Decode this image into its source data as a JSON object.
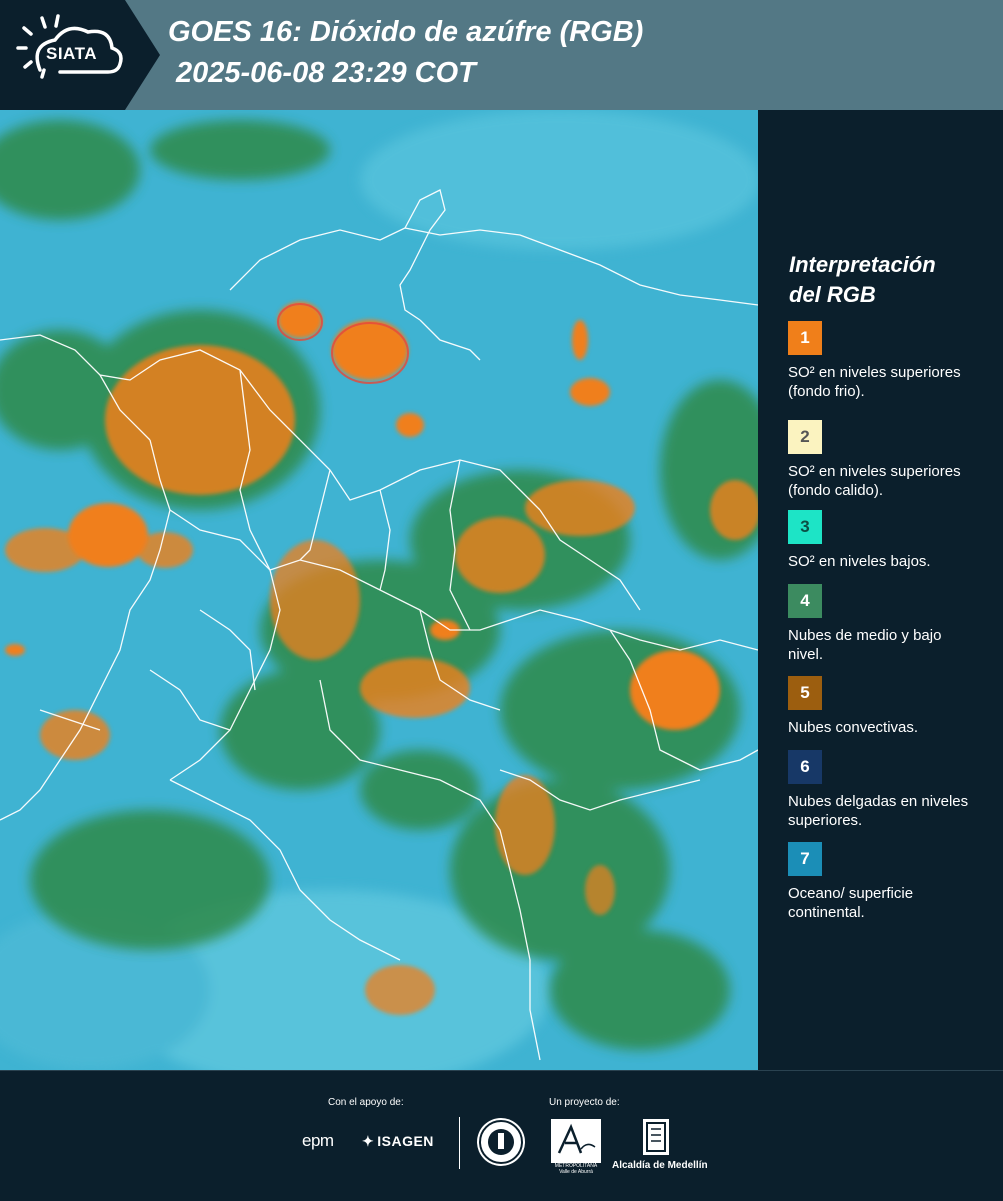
{
  "header": {
    "logo_text": "SIATA",
    "title": "GOES 16: Dióxido de azúfre (RGB)",
    "datetime": "2025-06-08 23:29 COT"
  },
  "legend": {
    "title_line1": "Interpretación",
    "title_line2": "del RGB",
    "items": [
      {
        "number": "1",
        "label": "SO² en niveles superiores (fondo frio).",
        "color": "#f07f1a",
        "text_color": "#ffffff"
      },
      {
        "number": "2",
        "label": "SO² en niveles superiores (fondo calido).",
        "color": "#fbf3c0",
        "text_color": "#555555"
      },
      {
        "number": "3",
        "label": "SO² en niveles bajos.",
        "color": "#1de4c6",
        "text_color": "#0b4f45"
      },
      {
        "number": "4",
        "label": "Nubes de medio y bajo nivel.",
        "color": "#3c8b60",
        "text_color": "#ffffff"
      },
      {
        "number": "5",
        "label": "Nubes convectivas.",
        "color": "#9c5e0f",
        "text_color": "#ffffff"
      },
      {
        "number": "6",
        "label": "Nubes delgadas en niveles superiores.",
        "color": "#173867",
        "text_color": "#ffffff"
      },
      {
        "number": "7",
        "label": "Oceano/ superficie continental.",
        "color": "#1b8eb7",
        "text_color": "#ffffff"
      }
    ]
  },
  "footer": {
    "support_label": "Con el apoyo de:",
    "project_label": "Un proyecto de:",
    "epm": "epm",
    "isagen": "ISAGEN",
    "area_text": "METROPOLITANA Valle de Aburrá",
    "alcaldia": "Alcaldía de Medellín"
  },
  "colors": {
    "header_bg": "#537885",
    "panel_bg": "#0b1f2c",
    "map_base": "#3fb3d2",
    "cloud_green": "#2f8a4a",
    "so2_orange": "#f07f1a"
  }
}
